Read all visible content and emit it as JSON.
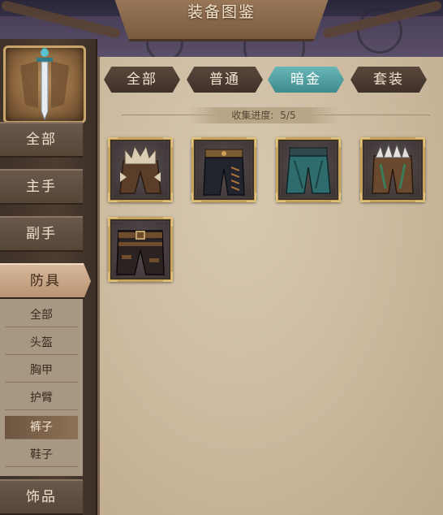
{
  "header": {
    "title": "装备图鉴"
  },
  "sidebar": {
    "categories": [
      {
        "label": "全部",
        "active": false
      },
      {
        "label": "主手",
        "active": false
      },
      {
        "label": "副手",
        "active": false
      },
      {
        "label": "防具",
        "active": true
      },
      {
        "label": "饰品",
        "active": false
      }
    ],
    "armor_sub": [
      {
        "label": "全部",
        "active": false
      },
      {
        "label": "头盔",
        "active": false
      },
      {
        "label": "胸甲",
        "active": false
      },
      {
        "label": "护臂",
        "active": false
      },
      {
        "label": "裤子",
        "active": true
      },
      {
        "label": "鞋子",
        "active": false
      }
    ]
  },
  "tabs": [
    {
      "label": "全部",
      "active": false
    },
    {
      "label": "普通",
      "active": false
    },
    {
      "label": "暗金",
      "active": true
    },
    {
      "label": "套装",
      "active": false
    }
  ],
  "progress": {
    "label": "收集进度:",
    "value": "5/5"
  },
  "items": [
    {
      "icon": "bone-spiked-legguards-icon"
    },
    {
      "icon": "dark-laced-trousers-icon"
    },
    {
      "icon": "teal-cloth-pants-icon"
    },
    {
      "icon": "fang-hide-legguards-icon"
    },
    {
      "icon": "belted-dark-pants-icon"
    }
  ],
  "colors": {
    "active_tab": "#4fa1a2",
    "card_border": "#c7a25a",
    "active_side": "#c9a383",
    "parchment": "#cbb99e"
  }
}
